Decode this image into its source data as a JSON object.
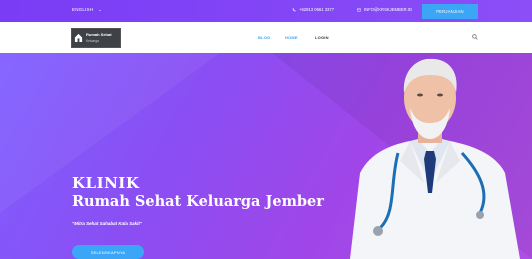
{
  "topbar": {
    "language": "ENGLISH",
    "phone": "+62813 0661 3377",
    "email": "INFO@KRSKJEMBER.ID",
    "cta_label": "PERJANJIAN"
  },
  "navbar": {
    "logo_title": "Rumah Sehat",
    "logo_subtitle": "Keluarga",
    "links": [
      "BLOG",
      "HOME",
      "LOGIN"
    ]
  },
  "hero": {
    "title": "KLINIK",
    "subtitle": "Rumah Sehat Keluarga Jember",
    "quote": "\"Mitra Sehat Sahabat Kala Sakit\"",
    "button_label": "SELENGKAPNYA"
  },
  "colors": {
    "primary": "#7a3cf5",
    "accent": "#3aa6f5"
  }
}
